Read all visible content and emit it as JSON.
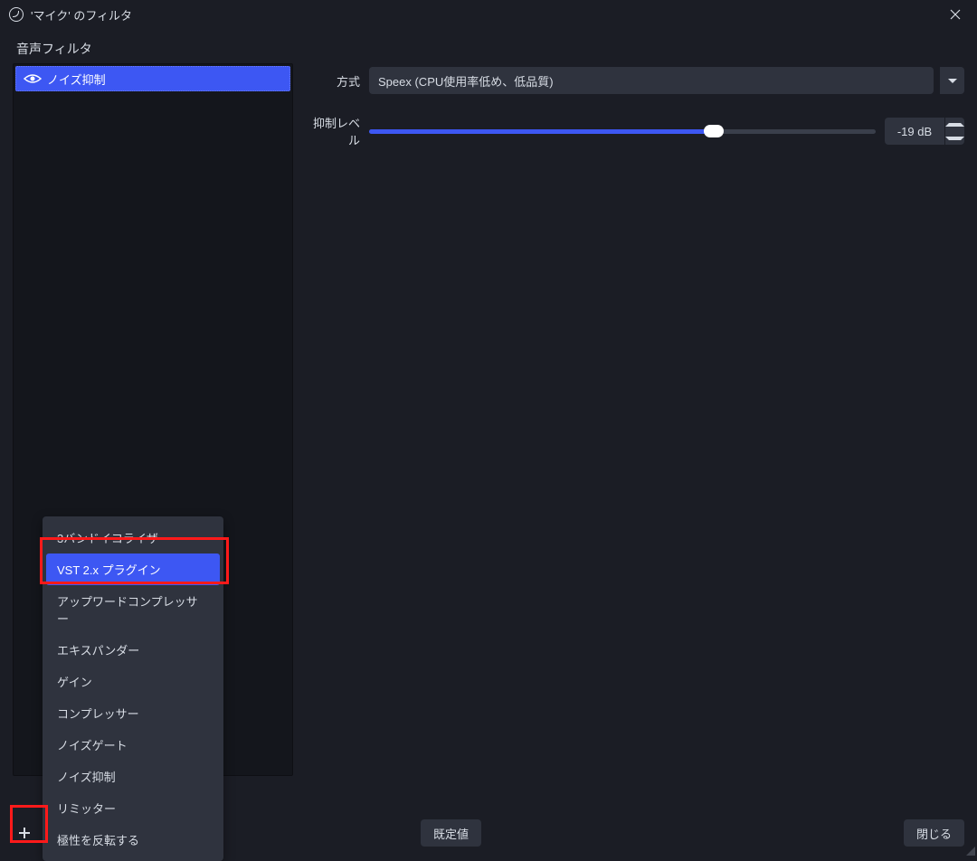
{
  "window": {
    "title": "'マイク' のフィルタ"
  },
  "section": {
    "audio_filters": "音声フィルタ"
  },
  "filters": {
    "items": [
      {
        "label": "ノイズ抑制"
      }
    ]
  },
  "props": {
    "method_label": "方式",
    "method_value": "Speex (CPU使用率低め、低品質)",
    "suppress_label": "抑制レベル",
    "suppress_value": "-19 dB"
  },
  "menu": {
    "items": [
      "3バンドイコライザー",
      "VST 2.x プラグイン",
      "アップワードコンプレッサー",
      "エキスパンダー",
      "ゲイン",
      "コンプレッサー",
      "ノイズゲート",
      "ノイズ抑制",
      "リミッター",
      "極性を反転する"
    ]
  },
  "buttons": {
    "defaults": "既定値",
    "close": "閉じる"
  }
}
